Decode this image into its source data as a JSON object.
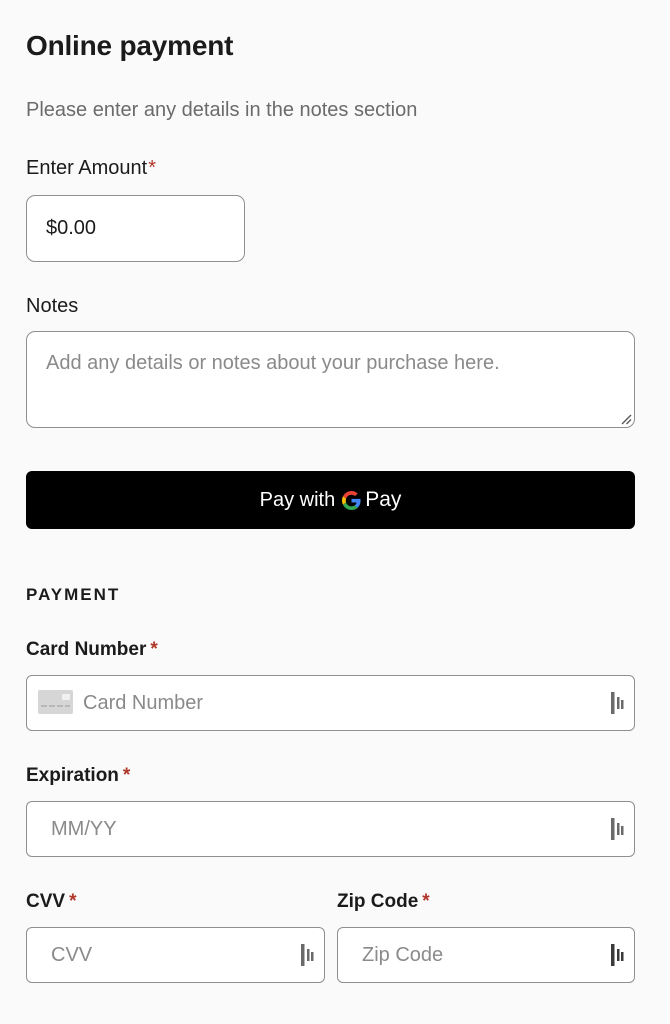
{
  "header": {
    "title": "Online payment",
    "subtitle": "Please enter any details in the notes section"
  },
  "amount": {
    "label": "Enter Amount",
    "required_mark": "*",
    "value": "$0.00"
  },
  "notes": {
    "label": "Notes",
    "placeholder": "Add any details or notes about your purchase here."
  },
  "gpay_button": {
    "prefix": "Pay with",
    "brand_letter": "G",
    "suffix": "Pay"
  },
  "payment": {
    "heading": "PAYMENT",
    "required_mark": "*",
    "card_number": {
      "label": "Card Number",
      "placeholder": "Card Number",
      "icon": "credit-card-icon"
    },
    "expiration": {
      "label": "Expiration",
      "placeholder": "MM/YY"
    },
    "cvv": {
      "label": "CVV",
      "placeholder": "CVV"
    },
    "zip": {
      "label": "Zip Code",
      "placeholder": "Zip Code"
    },
    "autofill_icon": "password-manager-icon"
  },
  "colors": {
    "required": "#b0362a",
    "button_bg": "#000000",
    "border": "#8f8f8f",
    "google_blue": "#4285F4",
    "google_red": "#EA4335",
    "google_yellow": "#FBBC05",
    "google_green": "#34A853"
  }
}
